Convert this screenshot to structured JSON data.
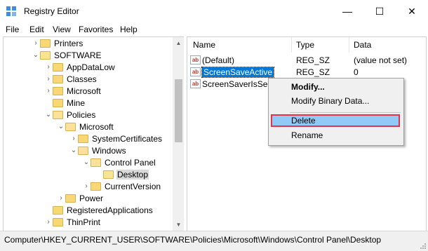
{
  "window": {
    "title": "Registry Editor",
    "minimize": "—",
    "maximize": "☐",
    "close": "✕"
  },
  "menu": [
    "File",
    "Edit",
    "View",
    "Favorites",
    "Help"
  ],
  "tree": {
    "selected": "Desktop",
    "items": [
      {
        "label": "Printers",
        "expander": "›"
      },
      {
        "label": "SOFTWARE",
        "expander": "⌄"
      },
      {
        "label": "AppDataLow",
        "expander": "›"
      },
      {
        "label": "Classes",
        "expander": "›"
      },
      {
        "label": "Microsoft",
        "expander": "›"
      },
      {
        "label": "Mine",
        "expander": ""
      },
      {
        "label": "Policies",
        "expander": "⌄"
      },
      {
        "label": "Microsoft",
        "expander": "⌄"
      },
      {
        "label": "SystemCertificates",
        "expander": "›"
      },
      {
        "label": "Windows",
        "expander": "⌄"
      },
      {
        "label": "Control Panel",
        "expander": "⌄"
      },
      {
        "label": "Desktop",
        "expander": ""
      },
      {
        "label": "CurrentVersion",
        "expander": "›"
      },
      {
        "label": "Power",
        "expander": "›"
      },
      {
        "label": "RegisteredApplications",
        "expander": ""
      },
      {
        "label": "ThinPrint",
        "expander": "›"
      }
    ]
  },
  "list": {
    "columns": [
      "Name",
      "Type",
      "Data"
    ],
    "rows": [
      {
        "name": "(Default)",
        "type": "REG_SZ",
        "data": "(value not set)"
      },
      {
        "name": "ScreenSaveActive",
        "type": "REG_SZ",
        "data": "0"
      },
      {
        "name": "ScreenSaverIsSecu",
        "type": "",
        "data": ""
      }
    ],
    "icon_text": "ab"
  },
  "context_menu": {
    "items": [
      "Modify...",
      "Modify Binary Data...",
      "Delete",
      "Rename"
    ],
    "highlighted": "Delete"
  },
  "status_bar": {
    "path": "Computer\\HKEY_CURRENT_USER\\SOFTWARE\\Policies\\Microsoft\\Windows\\Control Panel\\Desktop"
  },
  "colors": {
    "selection": "#0078d7",
    "menu_highlight": "#91c9f7",
    "annotation_border": "#e0354a",
    "folder": "#f8d775"
  }
}
